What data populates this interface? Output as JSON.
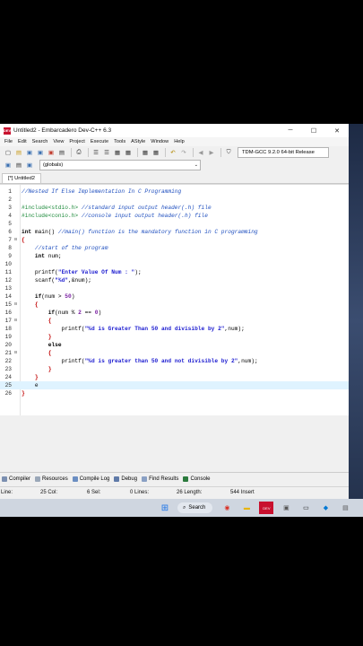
{
  "window": {
    "title": "Untitled2 - Embarcadero Dev-C++ 6.3",
    "app_icon": "DEV",
    "minimize": "─",
    "maximize": "☐",
    "close": "✕"
  },
  "menu": [
    "File",
    "Edit",
    "Search",
    "View",
    "Project",
    "Execute",
    "Tools",
    "AStyle",
    "Window",
    "Help"
  ],
  "toolbar": {
    "compiler": "TDM-GCC 9.2.0 64-bit Release",
    "globals": "(globals)"
  },
  "tab": {
    "label": "[*] Untitled2"
  },
  "code_lines": [
    {
      "n": "1",
      "fold": "",
      "html": "<span class='cm'>//Nested If Else Implementation In C Programming</span>"
    },
    {
      "n": "2",
      "fold": "",
      "html": ""
    },
    {
      "n": "3",
      "fold": "",
      "html": "<span class='pp'>#include&lt;stdio.h&gt;</span> <span class='cm'>//standard input output header(.h) file</span>"
    },
    {
      "n": "4",
      "fold": "",
      "html": "<span class='pp'>#include&lt;conio.h&gt;</span> <span class='cm'>//console input output header(.h) file</span>"
    },
    {
      "n": "5",
      "fold": "",
      "html": ""
    },
    {
      "n": "6",
      "fold": "",
      "html": "<span class='kw'>int</span> main() <span class='cm'>//main() function is the mandatory function in C programming</span>"
    },
    {
      "n": "7",
      "fold": "⊟",
      "html": "<span class='sy'>{</span>"
    },
    {
      "n": "8",
      "fold": "",
      "html": "    <span class='cm'>//start of the program</span>"
    },
    {
      "n": "9",
      "fold": "",
      "html": "    <span class='kw'>int</span> num;"
    },
    {
      "n": "10",
      "fold": "",
      "html": ""
    },
    {
      "n": "11",
      "fold": "",
      "html": "    printf(<span class='st'>\"Enter Value Of Num : \"</span>);"
    },
    {
      "n": "12",
      "fold": "",
      "html": "    scanf(<span class='st'>\"%d\"</span>,&amp;num);"
    },
    {
      "n": "13",
      "fold": "",
      "html": ""
    },
    {
      "n": "14",
      "fold": "",
      "html": "    <span class='kw'>if</span>(num &gt; <span class='nm'>50</span>)"
    },
    {
      "n": "15",
      "fold": "⊟",
      "html": "    <span class='sy'>{</span>"
    },
    {
      "n": "16",
      "fold": "",
      "html": "        <span class='kw'>if</span>(num % <span class='nm'>2</span> == <span class='nm'>0</span>)"
    },
    {
      "n": "17",
      "fold": "⊟",
      "html": "        <span class='sy'>{</span>"
    },
    {
      "n": "18",
      "fold": "",
      "html": "            printf(<span class='st'>\"%d is Greater Than 50 and divisible by 2\"</span>,num);"
    },
    {
      "n": "19",
      "fold": "",
      "html": "        <span class='sy'>}</span>"
    },
    {
      "n": "20",
      "fold": "",
      "html": "        <span class='kw'>else</span>"
    },
    {
      "n": "21",
      "fold": "⊟",
      "html": "        <span class='sy'>{</span>"
    },
    {
      "n": "22",
      "fold": "",
      "html": "            printf(<span class='st'>\"%d is greater than 50 and not divisible by 2\"</span>,num);"
    },
    {
      "n": "23",
      "fold": "",
      "html": "        <span class='sy'>}</span>"
    },
    {
      "n": "24",
      "fold": "",
      "html": "    <span class='sy'>}</span>"
    },
    {
      "n": "25",
      "fold": "",
      "html": "    e"
    },
    {
      "n": "26",
      "fold": "",
      "html": "<span class='sy'>}</span>"
    }
  ],
  "current_line": "25",
  "bottom_tabs": [
    "Compiler",
    "Resources",
    "Compile Log",
    "Debug",
    "Find Results",
    "Console"
  ],
  "status": {
    "line": "Line:",
    "col": "25 Col:",
    "sel": "6 Sel:",
    "lines": "0 Lines:",
    "length": "26 Length:",
    "insert": "544 Insert"
  },
  "taskbar": {
    "search": "Search"
  }
}
